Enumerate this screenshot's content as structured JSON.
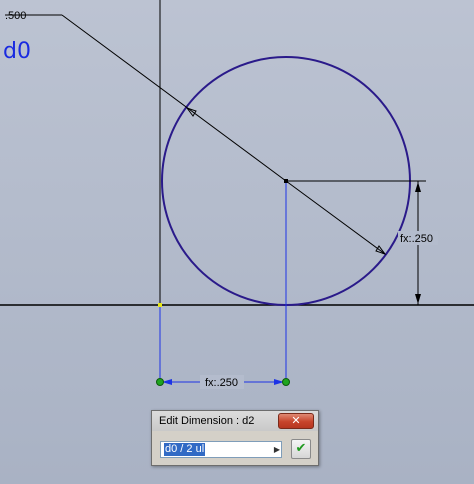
{
  "sketch": {
    "leader_dimension": ".500",
    "annotation": "d0",
    "vertical_dimension": "fx:.250",
    "horizontal_dimension": "fx:.250"
  },
  "colors": {
    "background": "#b4bccd",
    "circle": "#2a1a8a",
    "dimension_line": "#000000",
    "projection_line": "#1d33e6",
    "point": "#1fa51f",
    "annotation": "#1a2be0"
  },
  "icons": {
    "close": "close-icon",
    "dropdown": "chevron-right-icon",
    "accept": "checkmark-icon"
  },
  "dialog": {
    "title": "Edit Dimension : d2",
    "close_glyph": "✕",
    "expression_value": "d0 / 2 ul",
    "dropdown_glyph": "▶",
    "accept_glyph": "✔"
  }
}
